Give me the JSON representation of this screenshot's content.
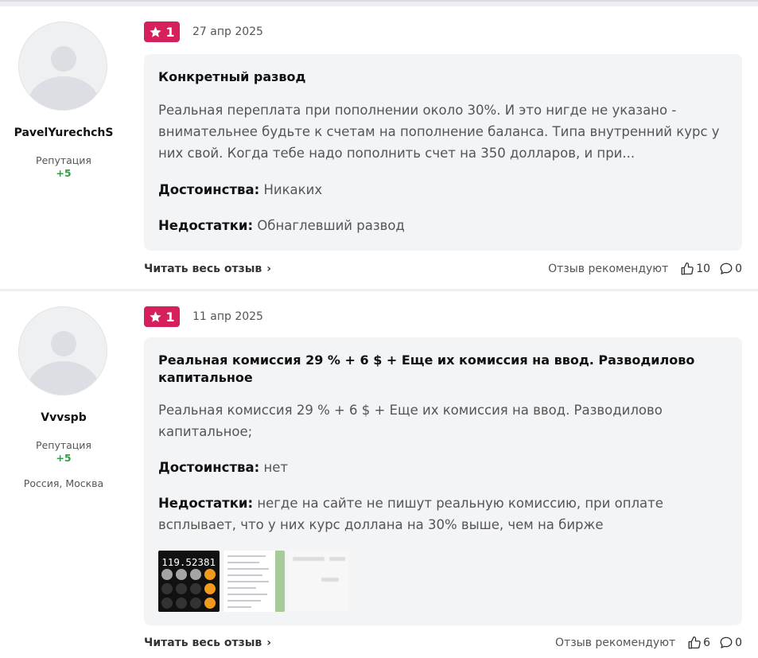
{
  "colors": {
    "badge": "#d6205c",
    "reputation": "#2ea043",
    "card": "#f3f4f6"
  },
  "reviews": [
    {
      "author": {
        "name": "PavelYurechchS",
        "reputation_label": "Репутация",
        "reputation_value": "+5",
        "location": ""
      },
      "rating": "1",
      "date": "27 апр 2025",
      "title": "Конкретный развод",
      "text": "Реальная переплата при пополнении около 30%. И это нигде не указано - внимательнее будьте к счетам на пополнение баланса. Типа внутренний курс у них свой. Когда тебе надо пополнить счет на 350 долларов, и при...",
      "pros_label": "Достоинства:",
      "pros": "Никаких",
      "cons_label": "Недостатки:",
      "cons": "Обнаглевший развод",
      "read_more": "Читать весь отзыв",
      "recommend_label": "Отзыв рекомендуют",
      "likes": "10",
      "comments": "0"
    },
    {
      "author": {
        "name": "Vvvspb",
        "reputation_label": "Репутация",
        "reputation_value": "+5",
        "location": "Россия, Москва"
      },
      "rating": "1",
      "date": "11 апр 2025",
      "title": "Реальная комиссия 29 % + 6 $ + Еще их комиссия на ввод. Разводилово капитальное",
      "text": "Реальная комиссия 29 % + 6 $ + Еще их комиссия на ввод. Разводилово капитальное;",
      "pros_label": "Достоинства:",
      "pros": "нет",
      "cons_label": "Недостатки:",
      "cons": "негде на сайте не пишут реальную комиссию, при оплате всплывает, что у них курс доллана на 30% выше, чем на бирже",
      "calc_display": "119.52381",
      "read_more": "Читать весь отзыв",
      "recommend_label": "Отзыв рекомендуют",
      "likes": "6",
      "comments": "0"
    }
  ],
  "icons": {
    "star": "star-icon",
    "chevron": "chevron-right-icon",
    "like": "thumbs-up-icon",
    "comment": "comment-icon"
  }
}
